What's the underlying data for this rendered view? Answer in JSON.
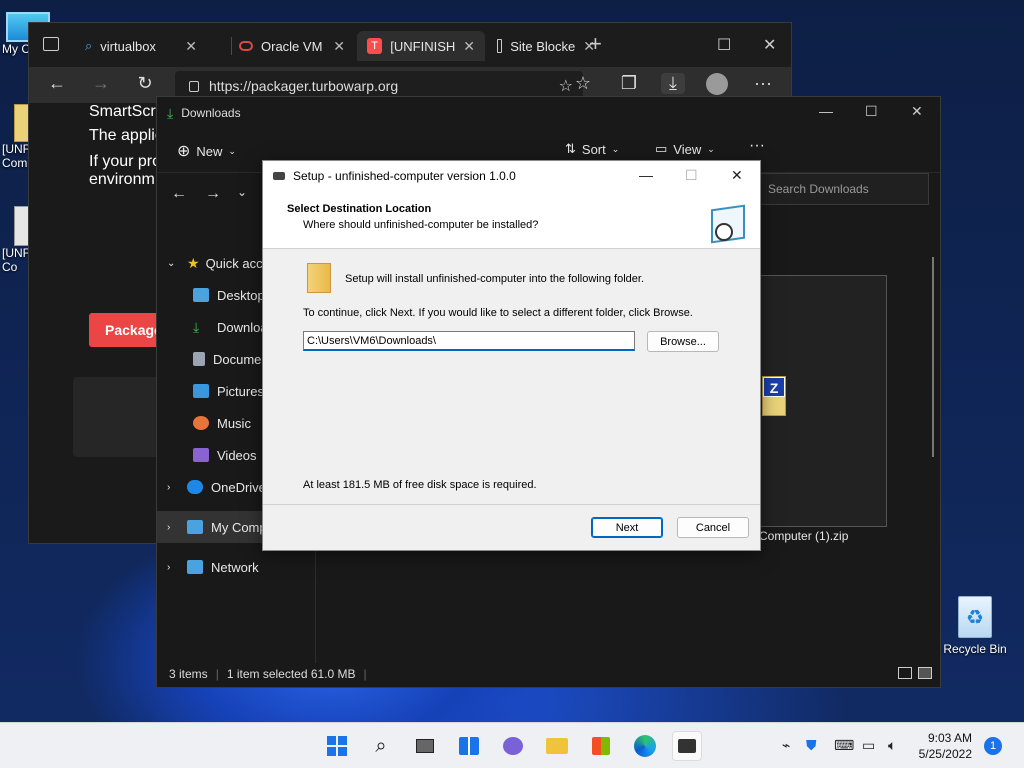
{
  "desktop": {
    "icons": [
      {
        "label": "My C"
      },
      {
        "label": "[UNF\nCom"
      },
      {
        "label": "[UNF\nCo"
      },
      {
        "label": "Recycle Bin"
      }
    ]
  },
  "browser": {
    "tabs": [
      {
        "label": "virtualbox"
      },
      {
        "label": "Oracle VM"
      },
      {
        "label": "[UNFINISH"
      },
      {
        "label": "Site Blocke"
      }
    ],
    "url": "https://packager.turbowarp.org",
    "page": {
      "line1": "SmartScr",
      "line2": "The applic",
      "line3": "If your pro",
      "line4": "environm",
      "button": "Package"
    }
  },
  "explorer": {
    "title": "Downloads",
    "toolbar": {
      "new": "New",
      "sort": "Sort",
      "view": "View",
      "more": "···"
    },
    "search_placeholder": "Search Downloads",
    "sidebar": [
      {
        "label": "Quick acce",
        "color": "#f0c419"
      },
      {
        "label": "Desktop",
        "color": "#4aa3df"
      },
      {
        "label": "Downloa",
        "color": "#3fb950"
      },
      {
        "label": "Documen",
        "color": "#9aa4b2"
      },
      {
        "label": "Pictures",
        "color": "#3a96dd"
      },
      {
        "label": "Music",
        "color": "#e8743b"
      },
      {
        "label": "Videos",
        "color": "#8a63d2"
      },
      {
        "label": "OneDrive",
        "color": "#1e88e5"
      },
      {
        "label": "My Compu",
        "color": "#4aa3df"
      },
      {
        "label": "Network",
        "color": "#4aa3df"
      }
    ],
    "file_label": "Computer (1).zip",
    "status": {
      "items": "3 items",
      "selected": "1 item selected  61.0 MB"
    }
  },
  "setup": {
    "title": "Setup - unfinished-computer version 1.0.0",
    "heading": "Select Destination Location",
    "subheading": "Where should unfinished-computer be installed?",
    "install_text": "Setup will install unfinished-computer into the following folder.",
    "continue_text": "To continue, click Next. If you would like to select a different folder, click Browse.",
    "path": "C:\\Users\\VM6\\Downloads\\",
    "browse": "Browse...",
    "disk_space": "At least 181.5 MB of free disk space is required.",
    "next": "Next",
    "cancel": "Cancel"
  },
  "taskbar": {
    "time": "9:03 AM",
    "date": "5/25/2022",
    "notifications": "1"
  }
}
